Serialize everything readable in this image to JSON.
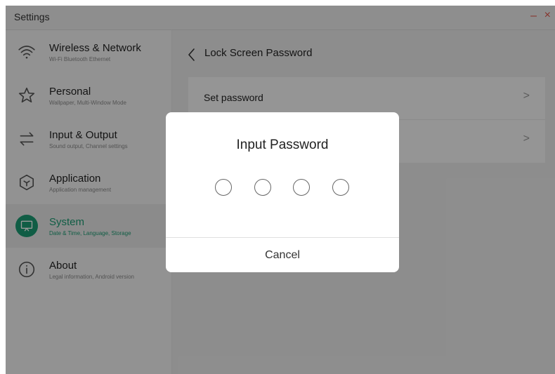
{
  "window": {
    "title": "Settings",
    "minimize_glyph": "–",
    "close_glyph": "×",
    "control_color": "#e0554a"
  },
  "sidebar": {
    "items": [
      {
        "title": "Wireless & Network",
        "subtitle": "Wi-Fi Bluetooth Ethernet",
        "icon": "wifi-icon"
      },
      {
        "title": "Personal",
        "subtitle": "Wallpaper, Multi-Window Mode",
        "icon": "star-icon"
      },
      {
        "title": "Input & Output",
        "subtitle": "Sound output, Channel settings",
        "icon": "swap-arrows-icon"
      },
      {
        "title": "Application",
        "subtitle": "Application management",
        "icon": "cube-icon"
      },
      {
        "title": "System",
        "subtitle": "Date & Time, Language, Storage",
        "icon": "monitor-icon",
        "active": true
      },
      {
        "title": "About",
        "subtitle": "Legal information, Android version",
        "icon": "info-icon"
      }
    ],
    "accent_color": "#1c9c73"
  },
  "main": {
    "page_title": "Lock Screen Password",
    "rows": [
      {
        "label": "Set password",
        "arrow": ">"
      },
      {
        "label": "",
        "arrow": ">"
      }
    ]
  },
  "dialog": {
    "title": "Input Password",
    "pin_length": 4,
    "pin_entered": 0,
    "cancel_label": "Cancel"
  }
}
